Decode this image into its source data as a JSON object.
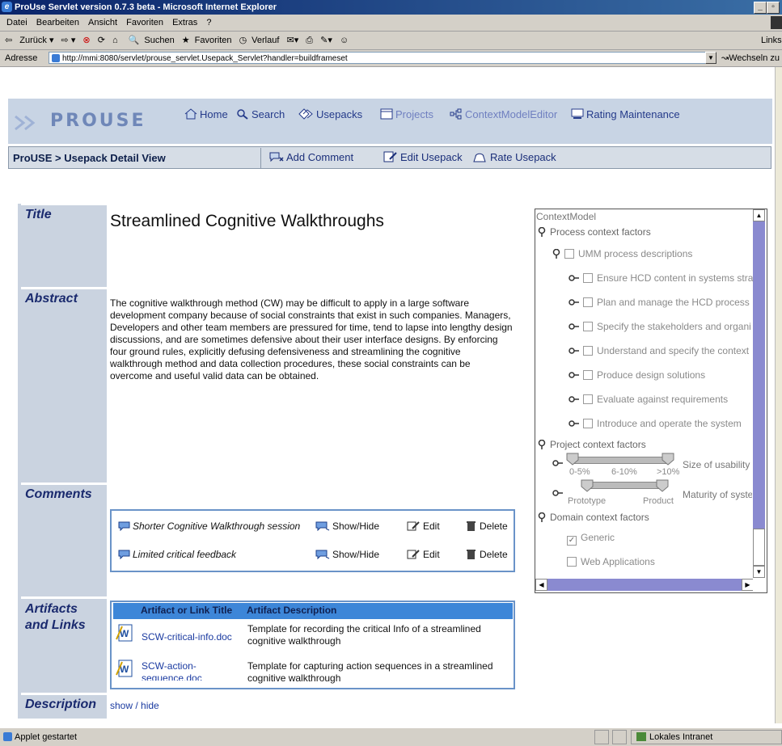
{
  "window": {
    "title": "ProUse Servlet version 0.7.3 beta - Microsoft Internet Explorer"
  },
  "menu": [
    "Datei",
    "Bearbeiten",
    "Ansicht",
    "Favoriten",
    "Extras",
    "?"
  ],
  "toolbar": {
    "back": "Zurück",
    "search": "Suchen",
    "favorites": "Favoriten",
    "history": "Verlauf",
    "links": "Links"
  },
  "address": {
    "label": "Adresse",
    "url": "http://mmi:8080/servlet/prouse_servlet.Usepack_Servlet?handler=buildframeset",
    "go": "Wechseln zu"
  },
  "app": {
    "logo": "PROUSE",
    "nav": [
      "Home",
      "Search",
      "Usepacks",
      "Projects",
      "ContextModelEditor",
      "Rating Maintenance"
    ]
  },
  "breadcrumb": "ProUSE > Usepack Detail View",
  "actions": {
    "add_comment": "Add Comment",
    "edit_usepack": "Edit Usepack",
    "rate_usepack": "Rate Usepack"
  },
  "usepack": {
    "labels": {
      "title": "Title",
      "abstract": "Abstract",
      "comments": "Comments",
      "artifacts": "Artifacts and Links",
      "description": "Description"
    },
    "title": "Streamlined Cognitive Walkthroughs",
    "abstract": "The cognitive walkthrough method (CW) may be difficult to apply in a large software development company because of social constraints that exist in such companies. Managers, Developers and other team members are pressured for time, tend to lapse into lengthy design discussions, and are sometimes defensive about their user interface designs. By enforcing four ground rules, explicitly defusing defensiveness and streamlining the cognitive walkthrough method and data collection procedures, these social constraints can be overcome and useful valid data can be obtained.",
    "comments": [
      {
        "title": "Shorter Cognitive Walkthrough session",
        "show": "Show/Hide",
        "edit": "Edit",
        "delete": "Delete"
      },
      {
        "title": "Limited critical feedback",
        "show": "Show/Hide",
        "edit": "Edit",
        "delete": "Delete"
      }
    ],
    "artifacts": {
      "headers": [
        "Artifact or Link Title",
        "Artifact Description"
      ],
      "rows": [
        {
          "title": "SCW-critical-info.doc",
          "description": "Template for recording the critical Info of a streamlined cognitive walkthrough"
        },
        {
          "title_line1": "SCW-action-",
          "title_line2": "sequence.doc",
          "description": "Template for capturing action sequences in a streamlined cognitive walkthrough"
        }
      ]
    },
    "description_toggle": "show / hide"
  },
  "context_model": {
    "title": "ContextModel",
    "process": "Process context factors",
    "umm": "UMM process descriptions",
    "umm_items": [
      "Ensure HCD content in systems stra",
      "Plan and manage the HCD process",
      "Specify the stakeholders and organi",
      "Understand and specify the context",
      "Produce design solutions",
      "Evaluate against requirements",
      "Introduce and operate the system"
    ],
    "project": "Project context factors",
    "size_ticks": [
      "0-5%",
      "6-10%",
      ">10%"
    ],
    "size_label": "Size of usability t",
    "maturity_ticks": [
      "Prototype",
      "Product"
    ],
    "maturity_label": "Maturity of syste",
    "domain": "Domain context factors",
    "domain_items": [
      {
        "label": "Generic",
        "checked": true
      },
      {
        "label": "Web Applications",
        "checked": false
      }
    ]
  },
  "status": {
    "left": "Applet gestartet",
    "zone": "Lokales Intranet"
  }
}
